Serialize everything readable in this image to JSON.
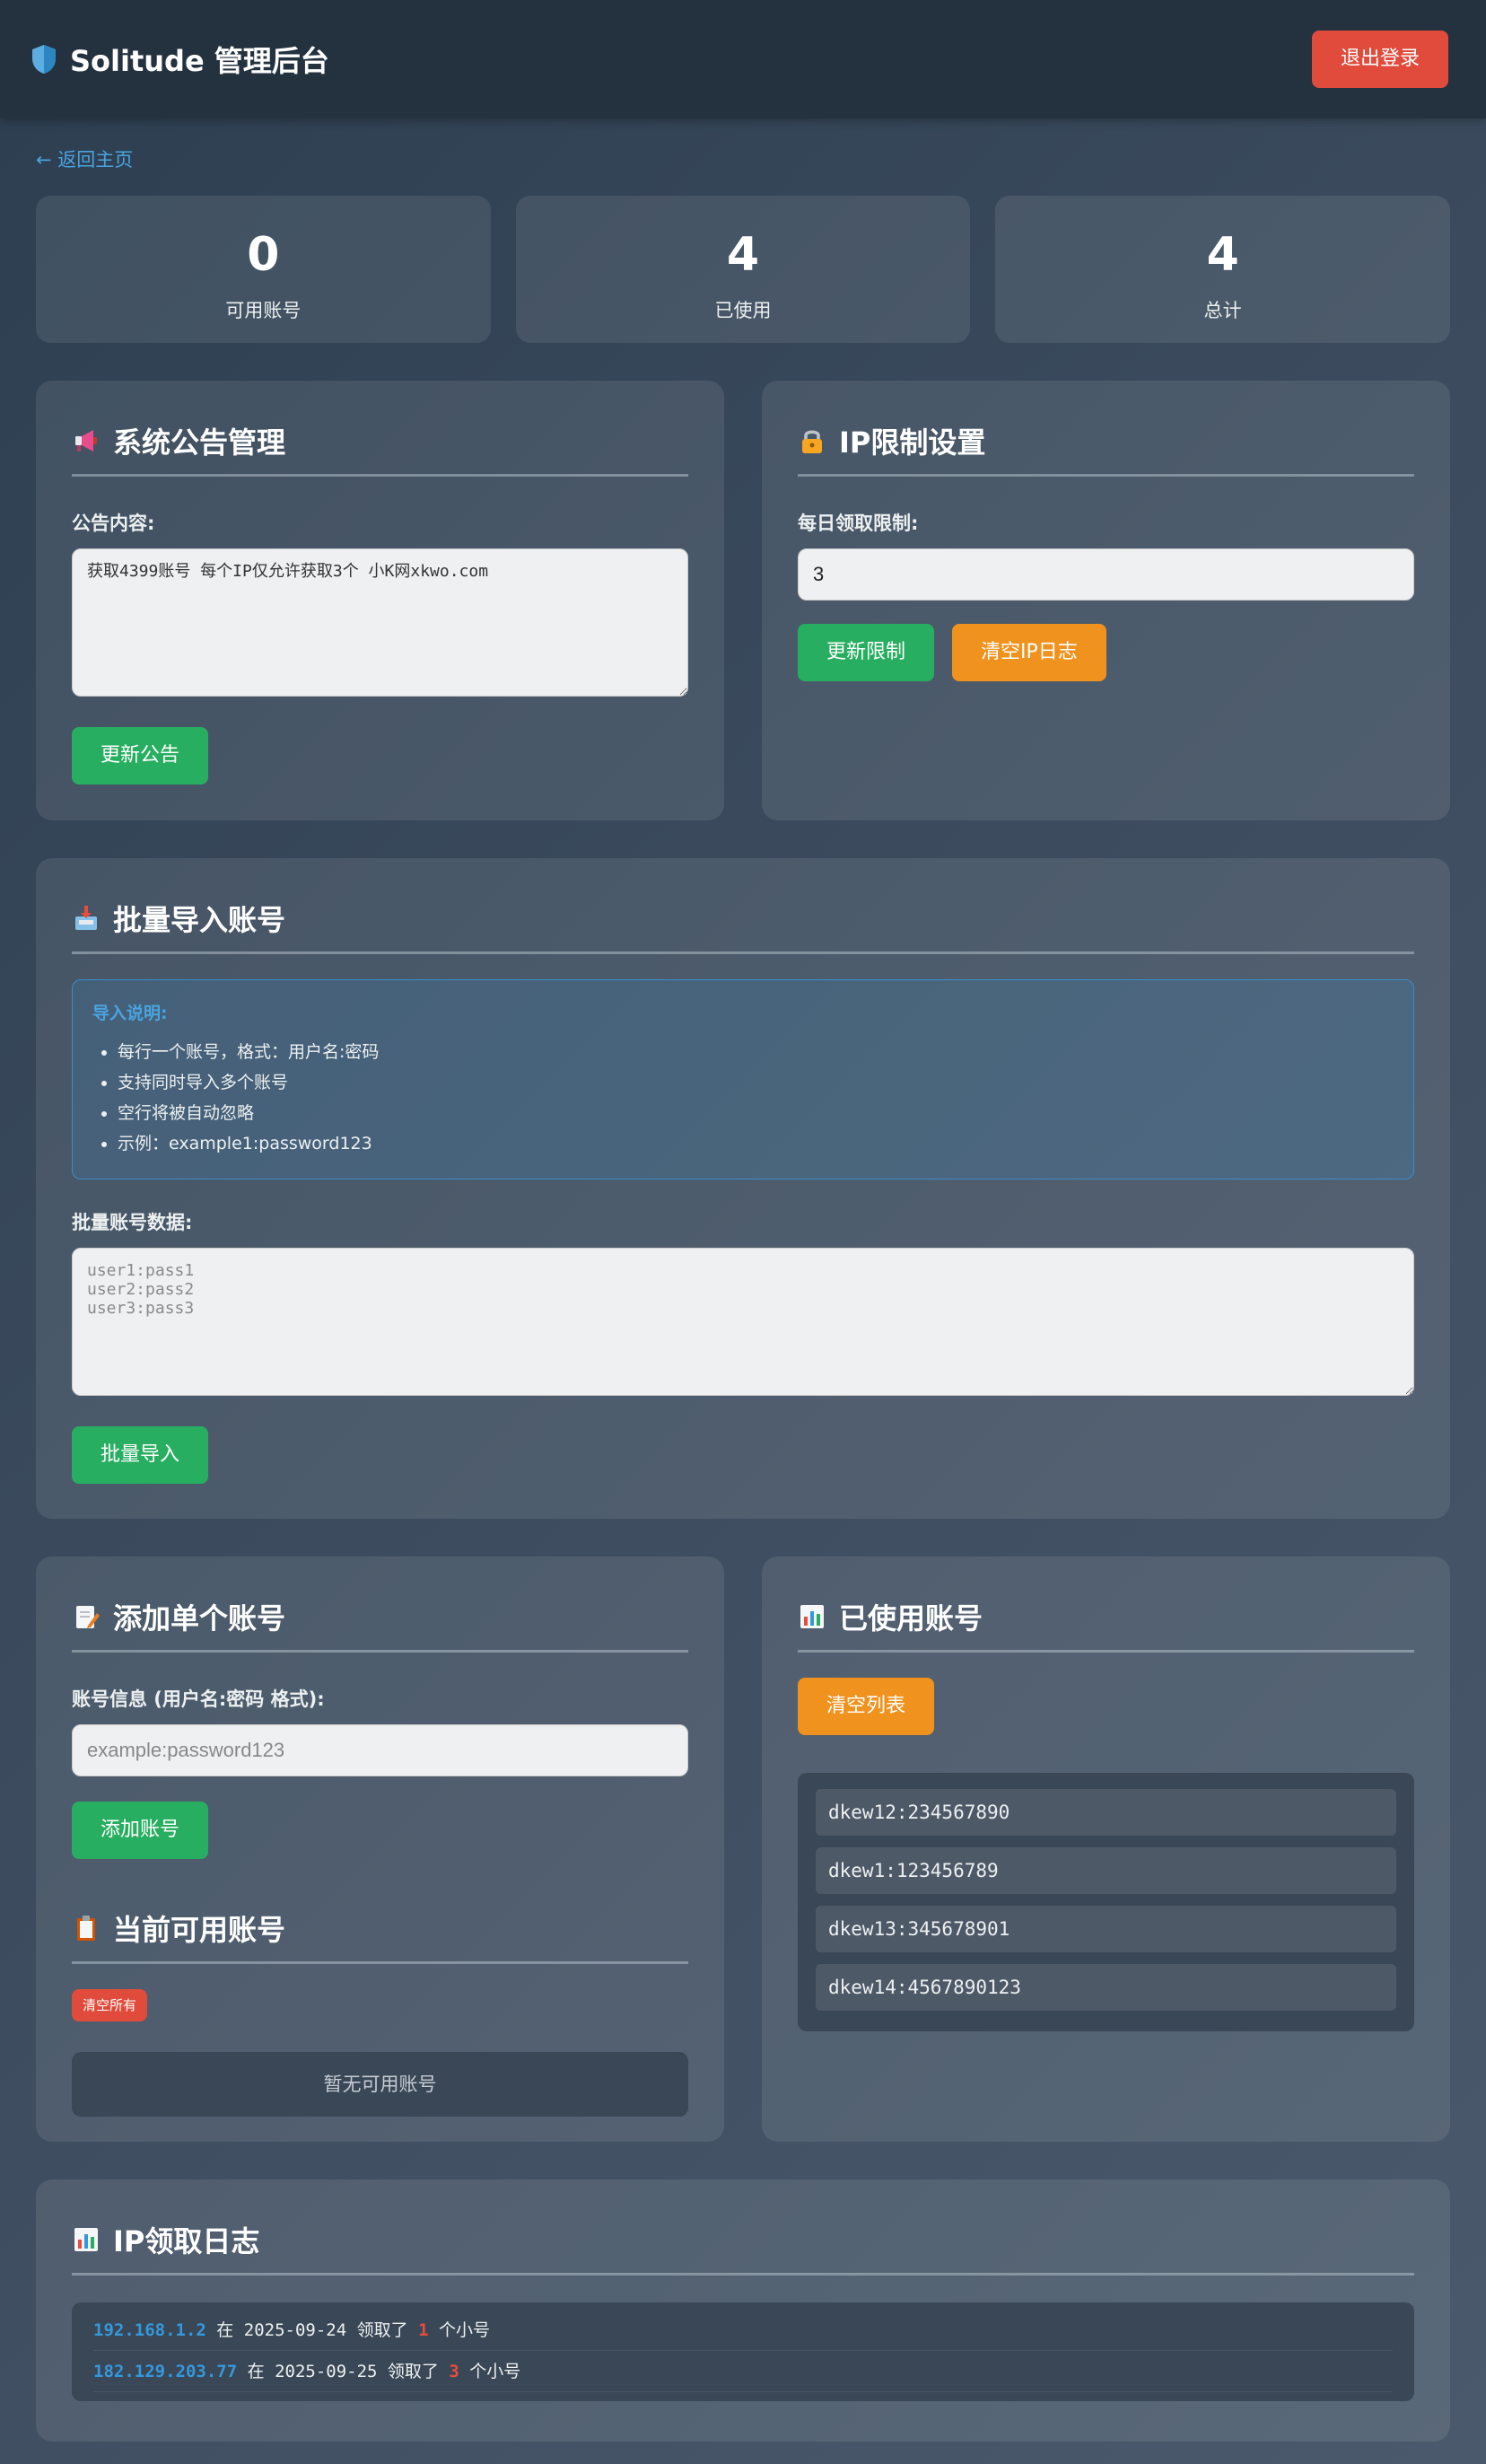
{
  "header": {
    "title": "Solitude 管理后台",
    "logout_label": "退出登录"
  },
  "nav": {
    "back_label": "← 返回主页"
  },
  "stats": [
    {
      "value": "0",
      "label": "可用账号"
    },
    {
      "value": "4",
      "label": "已使用"
    },
    {
      "value": "4",
      "label": "总计"
    }
  ],
  "announcement": {
    "title": "系统公告管理",
    "content_label": "公告内容:",
    "content_value": "获取4399账号 每个IP仅允许获取3个 小K网xkwo.com",
    "update_label": "更新公告"
  },
  "ip_limit": {
    "title": "IP限制设置",
    "daily_label": "每日领取限制:",
    "daily_value": "3",
    "update_label": "更新限制",
    "clear_label": "清空IP日志"
  },
  "batch_import": {
    "title": "批量导入账号",
    "info_title": "导入说明:",
    "info_items": [
      "每行一个账号，格式：用户名:密码",
      "支持同时导入多个账号",
      "空行将被自动忽略",
      "示例：example1:password123"
    ],
    "data_label": "批量账号数据:",
    "data_placeholder": "user1:pass1\nuser2:pass2\nuser3:pass3",
    "import_label": "批量导入"
  },
  "add_single": {
    "title": "添加单个账号",
    "field_label": "账号信息 (用户名:密码 格式):",
    "placeholder": "example:password123",
    "add_label": "添加账号"
  },
  "available": {
    "title": "当前可用账号",
    "clear_all_label": "清空所有",
    "empty_text": "暂无可用账号"
  },
  "used": {
    "title": "已使用账号",
    "clear_label": "清空列表",
    "items": [
      "dkew12:234567890",
      "dkew1:123456789",
      "dkew13:345678901",
      "dkew14:4567890123"
    ]
  },
  "ip_log": {
    "title": "IP领取日志",
    "entries": [
      {
        "ip": "192.168.1.2",
        "word_at": "在",
        "date": "2025-09-24",
        "word_got": "领取了",
        "count": "1",
        "unit": "个小号"
      },
      {
        "ip": "182.129.203.77",
        "word_at": "在",
        "date": "2025-09-25",
        "word_got": "领取了",
        "count": "3",
        "unit": "个小号"
      }
    ]
  },
  "colors": {
    "accent_blue": "#3498db",
    "success_green": "#27ae60",
    "warning_orange": "#f0921e",
    "danger_red": "#e04b3b"
  },
  "icons": {
    "brand": "shield-icon",
    "announcement": "megaphone-icon",
    "ip_limit": "lock-icon",
    "batch_import": "inbox-tray-icon",
    "add_single": "memo-pencil-icon",
    "available": "clipboard-icon",
    "used": "bar-chart-icon",
    "ip_log": "bar-chart-icon"
  }
}
